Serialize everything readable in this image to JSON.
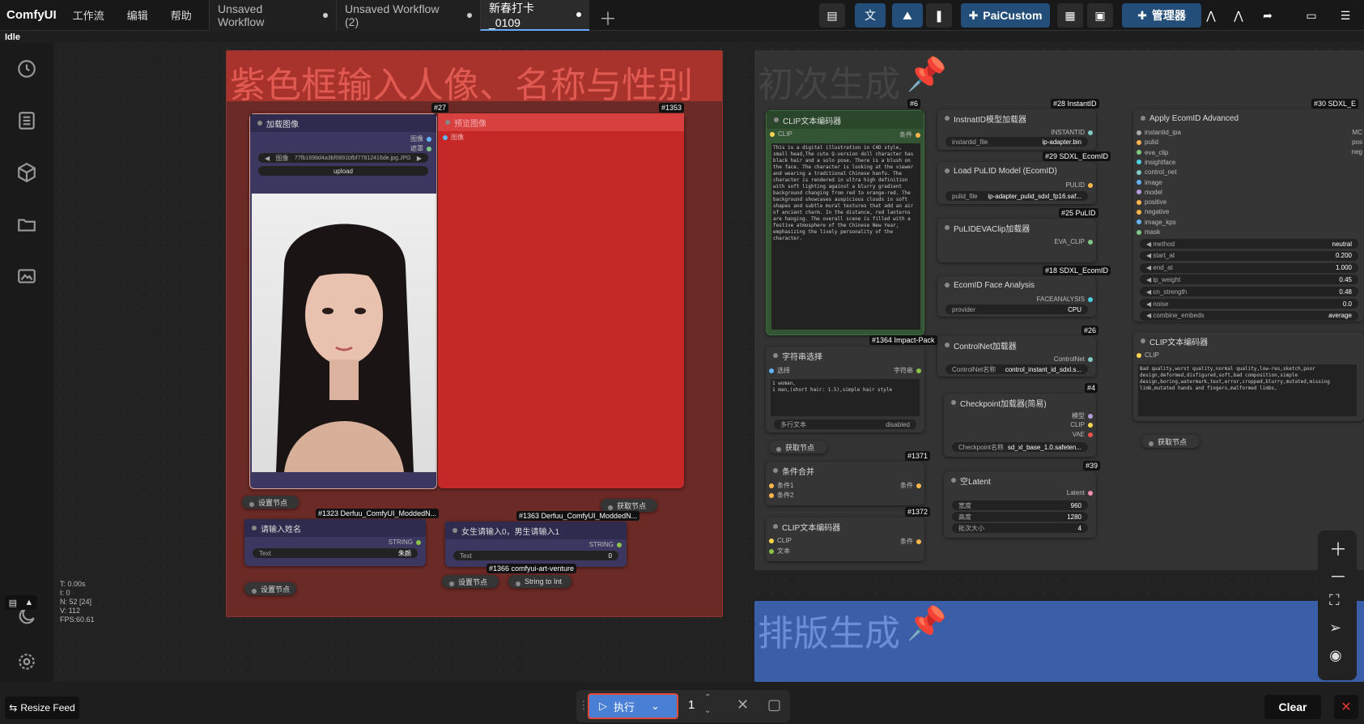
{
  "app": {
    "name": "ComfyUI",
    "menus": [
      "工作流",
      "编辑",
      "帮助"
    ]
  },
  "tabs": [
    {
      "label": "Unsaved Workflow"
    },
    {
      "label": "Unsaved Workflow (2)"
    },
    {
      "label": "新春打卡_0109"
    }
  ],
  "toolbar": {
    "paicustom": "PaiCustom",
    "manager": "管理器"
  },
  "status": {
    "idle": "Idle"
  },
  "stats": {
    "t": "T: 0.00s",
    "i": "I: 0",
    "n": "N: 52 [24]",
    "v": "V: 112",
    "fps": "FPS:60.61"
  },
  "groups": {
    "purple_title": "紫色框输入人像、名称与性别",
    "first_title": "初次生成",
    "layout_title": "排版生成"
  },
  "nodes": {
    "load_image": {
      "id": "#27",
      "title": "加载图像",
      "out_image": "图像",
      "out_mask": "遮罩",
      "file_label": "图像",
      "file": "77fb1698d4a3bf0891bfbf77812416de.jpg.JPG",
      "upload": "upload"
    },
    "preview": {
      "id": "#1353",
      "title": "预览图像",
      "in_image": "图像"
    },
    "set_node_1": {
      "title": "设置节点"
    },
    "get_node_1": {
      "title": "获取节点"
    },
    "name_input": {
      "id": "#1323 Derfuu_ComfyUI_ModdedN...",
      "title": "请输入姓名",
      "out": "STRING",
      "widget_label": "Text",
      "widget_value": "朱颜"
    },
    "gender_input": {
      "id": "#1363 Derfuu_ComfyUI_ModdedN...",
      "title": "女生请输入0，男生请输入1",
      "out": "STRING",
      "widget_label": "Text",
      "widget_value": "0"
    },
    "set_node_2": {
      "title": "设置节点"
    },
    "set_node_3": {
      "title": "设置节点"
    },
    "string_to_int": {
      "id": "#1366 comfyui-art-venture",
      "title": "String to Int"
    },
    "clip_encode": {
      "id": "#6",
      "title": "CLIP文本编码器",
      "in": "CLIP",
      "out": "条件",
      "text": "This is a digital illustration in C4D style, small head,The cute Q-version doll character has black hair and a solo pose. There is a blush on the face. The character is looking at the viewer and wearing a traditional Chinese hanfu. The character is rendered in ultra high definition with soft lighting against a blurry gradient background changing from red to orange-red. The background showcases auspicious clouds in soft shapes and subtle mural textures that add an air of ancient charm. In the distance, red lanterns are hanging. The overall scene is filled with a festive atmosphere of the Chinese New Year, emphasizing the lively personality of the character."
    },
    "instantid_loader": {
      "id": "#28 InstantID",
      "title": "InstnatID模型加载器",
      "out": "INSTANTID",
      "widget_label": "instantid_file",
      "widget_value": "ip-adapter.bin"
    },
    "pulid_loader": {
      "id": "#29 SDXL_EcomID",
      "title": "Load PuLID Model (EcomID)",
      "out": "PULID",
      "widget_label": "pulid_file",
      "widget_value": "ip-adapter_pulid_sdxl_fp16.saf..."
    },
    "evaclip": {
      "id": "#25 PuLID",
      "title": "PuLIDEVAClip加载器",
      "out": "EVA_CLIP"
    },
    "face_analysis": {
      "id": "#18 SDXL_EcomID",
      "title": "EcomID Face Analysis",
      "out": "FACEANALYSIS",
      "widget_label": "provider",
      "widget_value": "CPU"
    },
    "string_select": {
      "id": "#1364 Impact-Pack",
      "title": "字符串选择",
      "in": "选择",
      "out": "字符串",
      "text1": "1 woman,",
      "text2": "1 man,(short hair: 1.5),simple hair style",
      "multiline": "多行文本",
      "disabled": "disabled"
    },
    "controlnet_loader": {
      "id": "#26",
      "title": "ControlNet加载器",
      "out": "ControlNet",
      "widget_label": "ControlNet名称",
      "widget_value": "control_instant_id_sdxl.s..."
    },
    "checkpoint": {
      "id": "#4",
      "title": "Checkpoint加载器(简易)",
      "out_model": "模型",
      "out_clip": "CLIP",
      "out_vae": "VAE",
      "widget_label": "Checkpoint名称",
      "widget_value": "sd_xl_base_1.0.safeten..."
    },
    "get_node_2": {
      "title": "获取节点"
    },
    "cond_combine": {
      "id": "#1371",
      "title": "条件合并",
      "in1": "条件1",
      "in2": "条件2",
      "out": "条件"
    },
    "empty_latent": {
      "id": "#39",
      "title": "空Latent",
      "out": "Latent",
      "w_label": "宽度",
      "w_value": "960",
      "h_label": "高度",
      "h_value": "1280",
      "b_label": "批次大小",
      "b_value": "4"
    },
    "clip_encode2": {
      "id": "#1372",
      "title": "CLIP文本编码器",
      "in_clip": "CLIP",
      "in_text": "文本",
      "out": "条件"
    },
    "apply_ecomid": {
      "id": "#30 SDXL_E",
      "title": "Apply EcomID Advanced",
      "inputs": [
        "instantid_ipa",
        "pulid",
        "eva_clip",
        "insightface",
        "control_net",
        "image",
        "model",
        "positive",
        "negative",
        "image_kps",
        "mask"
      ],
      "params": [
        {
          "k": "method",
          "v": "neutral"
        },
        {
          "k": "start_at",
          "v": "0.200"
        },
        {
          "k": "end_at",
          "v": "1.000"
        },
        {
          "k": "ip_weight",
          "v": "0.45"
        },
        {
          "k": "cn_strength",
          "v": "0.48"
        },
        {
          "k": "noise",
          "v": "0.0"
        },
        {
          "k": "combine_embeds",
          "v": "average"
        }
      ],
      "right1": "MC",
      "right2": "pos",
      "right3": "neg"
    },
    "clip_neg": {
      "title": "CLIP文本编码器",
      "in": "CLIP",
      "text": "Bad quality,worst quality,normal quality,low-res,sketch,poor design,deformed,disfigured,soft,bad composition,simple design,boring,watermark,text,error,cropped,blurry,mutated,missing limb,mutated hands and fingers,malformed limbs,"
    },
    "get_node_3": {
      "title": "获取节点"
    }
  },
  "bottom": {
    "resize_feed": "Resize Feed",
    "run": "执行",
    "count": "1",
    "clear": "Clear"
  }
}
